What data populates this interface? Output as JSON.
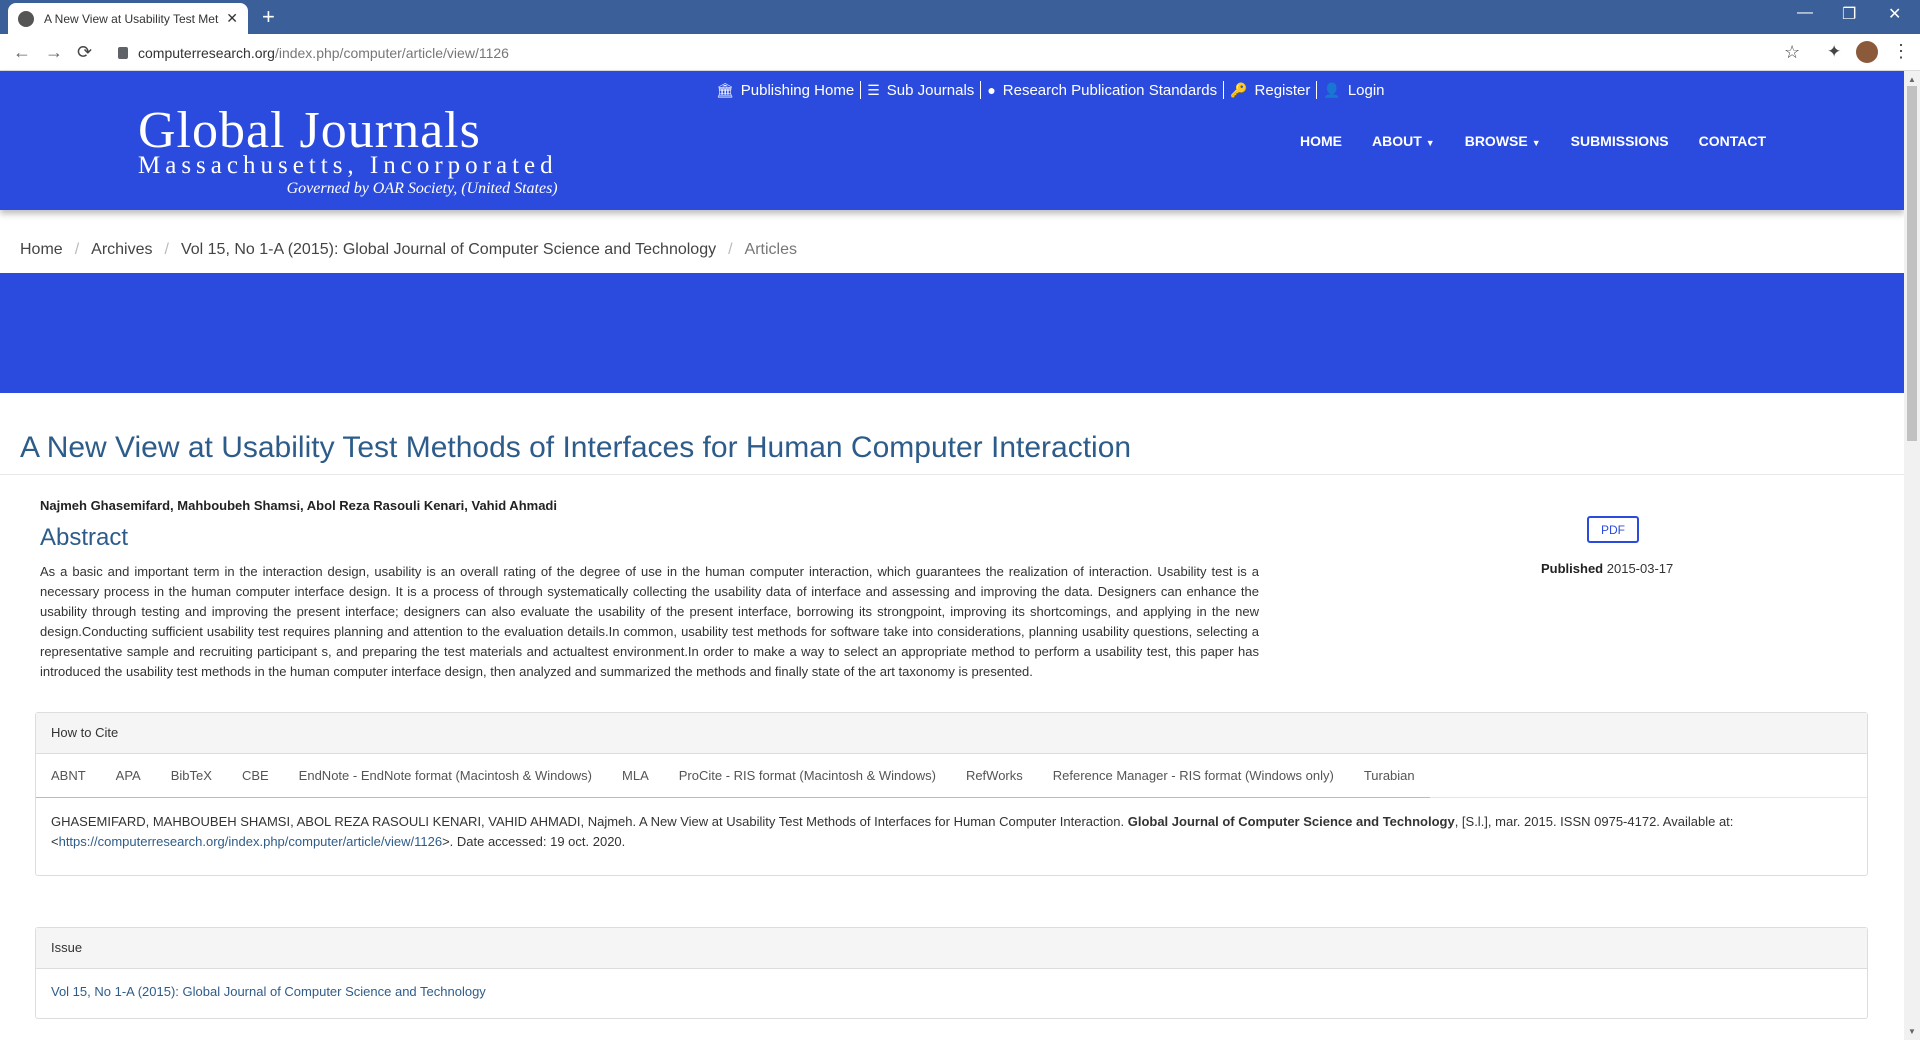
{
  "browser": {
    "tab_title": "A New View at Usability Test Met",
    "url_host": "computerresearch.org",
    "url_path": "/index.php/computer/article/view/1126",
    "newtab": "+",
    "back": "←",
    "forward": "→",
    "reload": "⟳",
    "minimize": "—",
    "restore": "❐",
    "close": "✕",
    "star": "☆",
    "ext": "✦",
    "menu": "⋮"
  },
  "header": {
    "logo_line1": "Global Journals",
    "logo_line2": "Massachusetts, Incorporated",
    "logo_line3": "Governed by OAR Society, (United States)",
    "toplinks": [
      {
        "icon": "🏛",
        "label": "Publishing Home"
      },
      {
        "icon": "☰",
        "label": "Sub Journals"
      },
      {
        "icon": "●",
        "label": "Research Publication Standards"
      },
      {
        "icon": "🔑",
        "label": "Register"
      },
      {
        "icon": "👤",
        "label": "Login"
      }
    ],
    "nav": [
      {
        "label": "HOME"
      },
      {
        "label": "ABOUT"
      },
      {
        "label": "BROWSE"
      },
      {
        "label": "SUBMISSIONS"
      },
      {
        "label": "CONTACT"
      }
    ]
  },
  "breadcrumb": {
    "items": [
      "Home",
      "Archives",
      "Vol 15, No 1-A (2015): Global Journal of Computer Science and Technology",
      "Articles"
    ]
  },
  "article": {
    "title": "A New View at Usability Test Methods of Interfaces for Human Computer Interaction",
    "authors": "Najmeh Ghasemifard, Mahboubeh Shamsi, Abol Reza Rasouli Kenari, Vahid Ahmadi",
    "abstract_heading": "Abstract",
    "abstract": "As a basic and important term in the interaction design, usability is an overall rating of the degree of use in the human computer interaction, which guarantees the realization of interaction. Usability test is a necessary process in the human computer interface design. It is a process of through systematically collecting the usability data of interface and assessing and improving the data. Designers can enhance the usability through testing and improving the present interface; designers can also evaluate the usability of the present interface, borrowing its strongpoint, improving its shortcomings, and applying in the new design.Conducting sufficient usability test requires planning and attention to the evaluation details.In common, usability test methods for software take into considerations, planning usability questions, selecting a representative sample and recruiting participant s, and preparing the test materials and actualtest environment.In order to make a way to select an appropriate method to perform a usability test, this paper has introduced the usability test methods in the human computer interface design, then analyzed and summarized the methods and finally state of the art taxonomy is presented.",
    "pdf_label": "PDF",
    "published_label": "Published",
    "published_date": "2015-03-17"
  },
  "cite": {
    "heading": "How to Cite",
    "tabs": [
      "ABNT",
      "APA",
      "BibTeX",
      "CBE",
      "EndNote - EndNote format (Macintosh & Windows)",
      "MLA",
      "ProCite - RIS format (Macintosh & Windows)",
      "RefWorks",
      "Reference Manager - RIS format (Windows only)",
      "Turabian"
    ],
    "text_part1": "GHASEMIFARD, MAHBOUBEH SHAMSI, ABOL REZA RASOULI KENARI, VAHID AHMADI, Najmeh. A New View at Usability Test Methods of Interfaces for Human Computer Interaction. ",
    "journal": "Global Journal of Computer Science and Technology",
    "text_part2": ", [S.l.], mar. 2015. ISSN 0975-4172. Available at: <",
    "link": "https://computerresearch.org/index.php/computer/article/view/1126",
    "text_part3": ">. Date accessed: 19 oct. 2020."
  },
  "issue": {
    "heading": "Issue",
    "link": "Vol 15, No 1-A (2015): Global Journal of Computer Science and Technology"
  },
  "colors": {
    "brand_blue": "#2a4bde",
    "link_blue": "#2e5c8a",
    "chrome_bar": "#3b5f98"
  }
}
